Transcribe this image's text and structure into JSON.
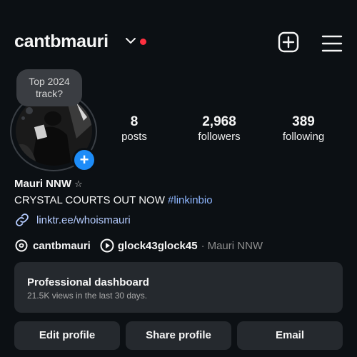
{
  "header": {
    "username": "cantbmauri"
  },
  "note": {
    "text_line1": "Top 2024",
    "text_line2": "track?"
  },
  "stats": [
    {
      "value": "8",
      "label": "posts"
    },
    {
      "value": "2,968",
      "label": "followers"
    },
    {
      "value": "389",
      "label": "following"
    }
  ],
  "bio": {
    "display_name": "Mauri NNW",
    "star": "☆",
    "text": "CRYSTAL COURTS OUT NOW ",
    "hashtag": "#linkinbio",
    "link": "linktr.ee/whoismauri"
  },
  "social": {
    "threads_name": "cantbmauri",
    "linked_account": "glock43glock45",
    "separator": "·",
    "linked_sub": "Mauri NNW"
  },
  "dashboard": {
    "title": "Professional dashboard",
    "subtitle": "21.5K views in the last 30 days."
  },
  "buttons": {
    "edit": "Edit profile",
    "share": "Share profile",
    "email": "Email"
  },
  "colors": {
    "background": "#0c1014",
    "notification_dot": "#ff3040",
    "add_badge": "#1d8cf8",
    "link": "#b4cbff",
    "card": "#25292e"
  },
  "icons": [
    "chevron-down-icon",
    "new-post-icon",
    "menu-icon",
    "add-story-icon",
    "link-icon",
    "threads-icon",
    "play-circle-icon"
  ]
}
